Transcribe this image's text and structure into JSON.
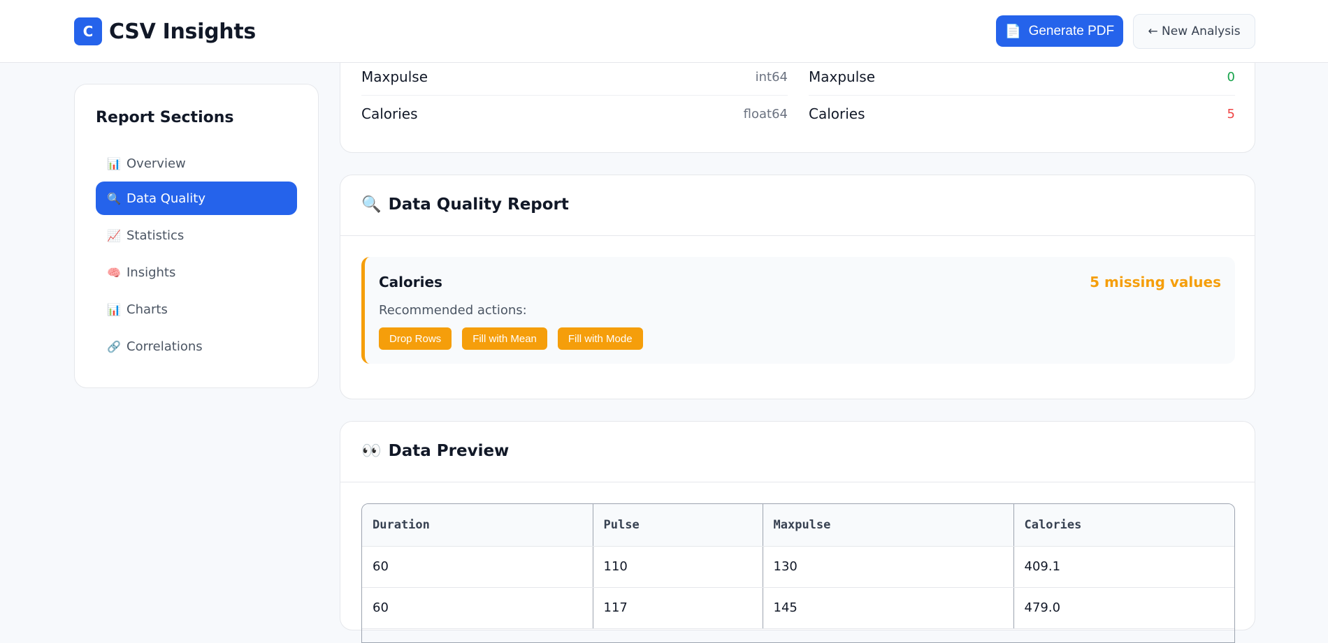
{
  "header": {
    "logo_letter": "C",
    "title": "CSV Insights",
    "generate_pdf_icon": "📄",
    "generate_pdf_label": "Generate PDF",
    "new_analysis_label": "← New Analysis"
  },
  "sidebar": {
    "title": "Report Sections",
    "items": [
      {
        "icon": "📊",
        "label": "Overview",
        "active": false
      },
      {
        "icon": "🔍",
        "label": "Data Quality",
        "active": true
      },
      {
        "icon": "📈",
        "label": "Statistics",
        "active": false
      },
      {
        "icon": "🧠",
        "label": "Insights",
        "active": false
      },
      {
        "icon": "📊",
        "label": "Charts",
        "active": false
      },
      {
        "icon": "🔗",
        "label": "Correlations",
        "active": false
      }
    ]
  },
  "overview": {
    "types": [
      {
        "column": "Maxpulse",
        "dtype": "int64"
      },
      {
        "column": "Calories",
        "dtype": "float64"
      }
    ],
    "missing": [
      {
        "column": "Maxpulse",
        "count": "0",
        "color": "#16a34a"
      },
      {
        "column": "Calories",
        "count": "5",
        "color": "#ef4444"
      }
    ]
  },
  "data_quality": {
    "icon": "🔍",
    "title": "Data Quality Report",
    "issue": {
      "column": "Calories",
      "missing_text": "5 missing values",
      "recommended_label": "Recommended actions:",
      "actions": [
        "Drop Rows",
        "Fill with Mean",
        "Fill with Mode"
      ]
    }
  },
  "preview": {
    "icon": "👀",
    "title": "Data Preview",
    "columns": [
      "Duration",
      "Pulse",
      "Maxpulse",
      "Calories"
    ],
    "rows": [
      [
        "60",
        "110",
        "130",
        "409.1"
      ],
      [
        "60",
        "117",
        "145",
        "479.0"
      ]
    ]
  },
  "colors": {
    "accent": "#2563eb",
    "warning": "#f59e0b",
    "success": "#16a34a",
    "danger": "#ef4444"
  }
}
